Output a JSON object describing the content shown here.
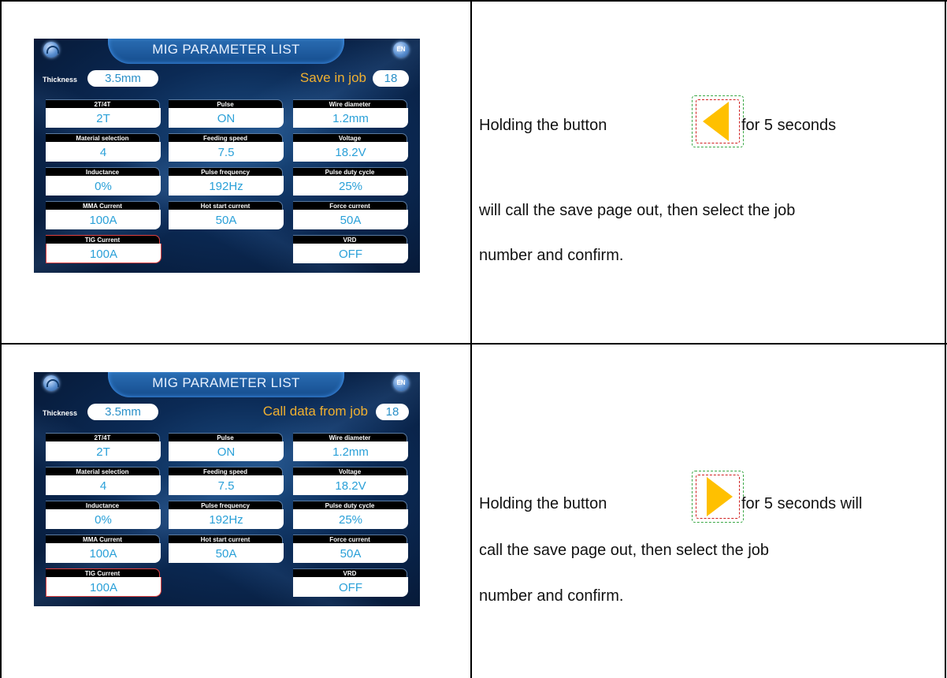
{
  "rows": [
    {
      "screen": {
        "title": "MIG PARAMETER LIST",
        "lang_badge": "EN",
        "thickness_label": "Thickness",
        "thickness_value": "3.5mm",
        "job_label": "Save in job",
        "job_value": "18",
        "params": [
          {
            "label": "2T/4T",
            "value": "2T"
          },
          {
            "label": "Pulse",
            "value": "ON"
          },
          {
            "label": "Wire diameter",
            "value": "1.2mm"
          },
          {
            "label": "Material selection",
            "value": "4"
          },
          {
            "label": "Feeding speed",
            "value": "7.5"
          },
          {
            "label": "Voltage",
            "value": "18.2V"
          },
          {
            "label": "Inductance",
            "value": "0%"
          },
          {
            "label": "Pulse frequency",
            "value": "192Hz"
          },
          {
            "label": "Pulse duty cycle",
            "value": "25%"
          },
          {
            "label": "MMA Current",
            "value": "100A"
          },
          {
            "label": "Hot start current",
            "value": "50A"
          },
          {
            "label": "Force current",
            "value": "50A"
          },
          {
            "label": "TIG Current",
            "value": "100A"
          },
          {
            "label": "VRD",
            "value": "OFF"
          }
        ]
      },
      "instruction": {
        "before_icon": "Holding the button",
        "after_icon": "for 5 seconds",
        "line2": "will call the save page out, then select the job",
        "line3": "number and confirm.",
        "icon": "left-arrow-icon",
        "icon_color": "#ffc000"
      }
    },
    {
      "screen": {
        "title": "MIG PARAMETER LIST",
        "lang_badge": "EN",
        "thickness_label": "Thickness",
        "thickness_value": "3.5mm",
        "job_label": "Call data from job",
        "job_value": "18",
        "params": [
          {
            "label": "2T/4T",
            "value": "2T"
          },
          {
            "label": "Pulse",
            "value": "ON"
          },
          {
            "label": "Wire diameter",
            "value": "1.2mm"
          },
          {
            "label": "Material selection",
            "value": "4"
          },
          {
            "label": "Feeding speed",
            "value": "7.5"
          },
          {
            "label": "Voltage",
            "value": "18.2V"
          },
          {
            "label": "Inductance",
            "value": "0%"
          },
          {
            "label": "Pulse frequency",
            "value": "192Hz"
          },
          {
            "label": "Pulse duty cycle",
            "value": "25%"
          },
          {
            "label": "MMA Current",
            "value": "100A"
          },
          {
            "label": "Hot start current",
            "value": "50A"
          },
          {
            "label": "Force current",
            "value": "50A"
          },
          {
            "label": "TIG Current",
            "value": "100A"
          },
          {
            "label": "VRD",
            "value": "OFF"
          }
        ]
      },
      "instruction": {
        "before_icon": "Holding the button",
        "after_icon": "for 5 seconds will",
        "line2": "call the save page out, then select the job",
        "line3": "number and confirm.",
        "icon": "right-arrow-icon",
        "icon_color": "#ffc000"
      }
    }
  ]
}
